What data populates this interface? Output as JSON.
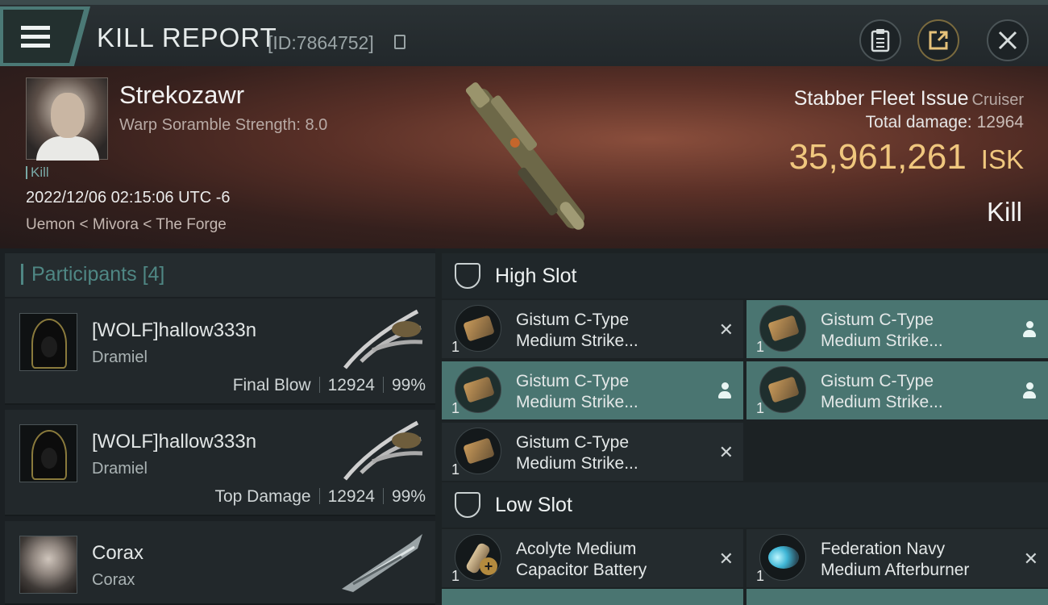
{
  "header": {
    "title": "KILL REPORT",
    "report_id": "[ID:7864752]"
  },
  "victim": {
    "name": "Strekozawr",
    "subtitle": "Warp Soramble Strength: 8.0",
    "kill_tag": "Kill",
    "datetime": "2022/12/06 02:15:06 UTC -6",
    "location": "Uemon < Mivora < The Forge"
  },
  "ship": {
    "name": "Stabber Fleet Issue",
    "class": "Cruiser",
    "total_damage_label": "Total damage:",
    "total_damage": "12964",
    "isk_value": "35,961,261",
    "isk_unit": "ISK",
    "result": "Kill"
  },
  "participants": {
    "header": "Participants",
    "count": "[4]",
    "items": [
      {
        "name": "[WOLF]hallow333n",
        "ship": "Dramiel",
        "role": "Final Blow",
        "damage": "12924",
        "percent": "99%"
      },
      {
        "name": "[WOLF]hallow333n",
        "ship": "Dramiel",
        "role": "Top Damage",
        "damage": "12924",
        "percent": "99%"
      },
      {
        "name": "Corax",
        "ship": "Corax"
      }
    ]
  },
  "slots": {
    "high": {
      "label": "High Slot",
      "modules": [
        {
          "qty": "1",
          "line1": "Gistum C-Type",
          "line2": "Medium Strike...",
          "status": "destroyed",
          "status_text": "✕"
        },
        {
          "qty": "1",
          "line1": "Gistum C-Type",
          "line2": "Medium Strike...",
          "status": "dropped"
        },
        {
          "qty": "1",
          "line1": "Gistum C-Type",
          "line2": "Medium Strike...",
          "status": "dropped"
        },
        {
          "qty": "1",
          "line1": "Gistum C-Type",
          "line2": "Medium Strike...",
          "status": "dropped"
        },
        {
          "qty": "1",
          "line1": "Gistum C-Type",
          "line2": "Medium Strike...",
          "status": "destroyed",
          "status_text": "✕"
        }
      ]
    },
    "low": {
      "label": "Low Slot",
      "modules": [
        {
          "qty": "1",
          "line1": "Acolyte Medium",
          "line2": "Capacitor Battery",
          "status": "destroyed",
          "status_text": "✕"
        },
        {
          "qty": "1",
          "line1": "Federation Navy",
          "line2": "Medium Afterburner",
          "status": "destroyed",
          "status_text": "✕"
        }
      ]
    }
  },
  "colors": {
    "accent_teal": "#4a7571",
    "isk_gold": "#f0c77e"
  }
}
